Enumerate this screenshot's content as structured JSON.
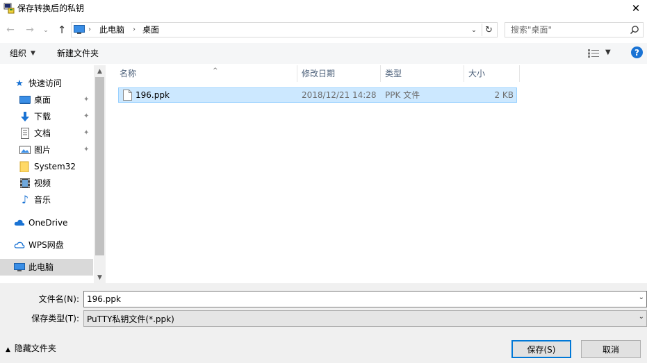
{
  "window": {
    "title": "保存转换后的私钥",
    "close_glyph": "✕"
  },
  "nav": {
    "back_glyph": "←",
    "forward_glyph": "→",
    "recent_glyph": "⌄",
    "up_glyph": "↑"
  },
  "address": {
    "crumbs": [
      "此电脑",
      "桌面"
    ],
    "separator": "›",
    "dropdown_glyph": "⌄",
    "refresh_glyph": "↻"
  },
  "search": {
    "placeholder": "搜索\"桌面\""
  },
  "toolbar": {
    "organize_label": "组织",
    "organize_caret": "▼",
    "new_folder_label": "新建文件夹",
    "view_caret": "▼",
    "help_label": "?"
  },
  "sidebar": {
    "quick_access": "快速访问",
    "items": [
      {
        "label": "桌面",
        "icon": "desktop-icon",
        "pinned": true
      },
      {
        "label": "下载",
        "icon": "download-icon",
        "pinned": true
      },
      {
        "label": "文档",
        "icon": "document-icon",
        "pinned": true
      },
      {
        "label": "图片",
        "icon": "picture-icon",
        "pinned": true
      },
      {
        "label": "System32",
        "icon": "folder-icon",
        "pinned": false
      },
      {
        "label": "视频",
        "icon": "video-icon",
        "pinned": false
      },
      {
        "label": "音乐",
        "icon": "music-icon",
        "pinned": false
      }
    ],
    "onedrive": "OneDrive",
    "wps": "WPS网盘",
    "this_pc": "此电脑",
    "pin_glyph": "📌"
  },
  "scrollbar": {
    "up_glyph": "▲",
    "down_glyph": "▼"
  },
  "columns": {
    "name": "名称",
    "modified": "修改日期",
    "type": "类型",
    "size": "大小",
    "sort_glyph": "^"
  },
  "files": [
    {
      "name": "196.ppk",
      "modified": "2018/12/21 14:28",
      "type": "PPK 文件",
      "size": "2 KB"
    }
  ],
  "form": {
    "filename_label": "文件名(N):",
    "filename_value": "196.ppk",
    "filetype_label": "保存类型(T):",
    "filetype_value": "PuTTY私钥文件(*.ppk)",
    "caret_glyph": "⌄"
  },
  "footer": {
    "hide_folders_caret": "▲",
    "hide_folders_label": "隐藏文件夹",
    "save_label": "保存(S)",
    "cancel_label": "取消"
  },
  "colors": {
    "accent": "#0078d7",
    "selection": "#cce8ff",
    "help_blue": "#1a73d4"
  }
}
